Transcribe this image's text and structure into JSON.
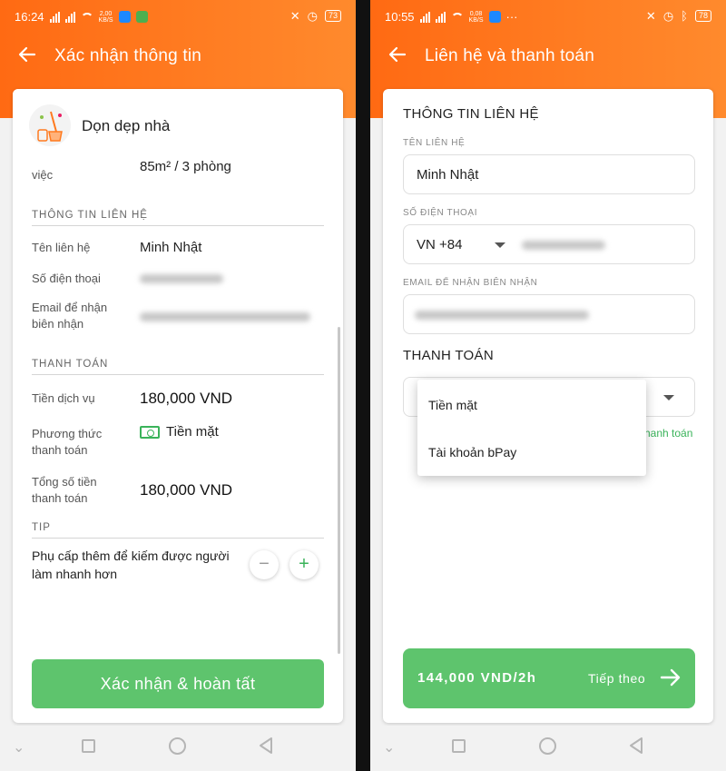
{
  "left": {
    "status": {
      "time": "16:24",
      "data_rate": "2,00\nKB/S",
      "battery": "73"
    },
    "appbar": {
      "title": "Xác nhận thông tin"
    },
    "service": {
      "name": "Dọn dẹp nhà"
    },
    "workload": {
      "label_partial": "việc",
      "value": "85m² / 3 phòng"
    },
    "contact": {
      "section": "THÔNG TIN LIÊN HỆ",
      "name_label": "Tên liên hệ",
      "name_value": "Minh Nhật",
      "phone_label": "Số điện thoại",
      "email_label_1": "Email để nhận",
      "email_label_2": "biên nhận"
    },
    "payment": {
      "section": "THANH TOÁN",
      "service_fee_label": "Tiền dịch vụ",
      "service_fee_value": "180,000 VND",
      "method_label_1": "Phương thức",
      "method_label_2": "thanh toán",
      "method_value": "Tiền mặt",
      "total_label_1": "Tổng số tiền",
      "total_label_2": "thanh toán",
      "total_value": "180,000 VND"
    },
    "tip": {
      "section": "TIP",
      "text": "Phụ cấp thêm để kiếm được người làm nhanh hơn",
      "minus": "−",
      "plus": "+"
    },
    "cta": "Xác nhận & hoàn tất"
  },
  "right": {
    "status": {
      "time": "10:55",
      "data_rate": "0,08\nKB/S",
      "battery": "78"
    },
    "appbar": {
      "title": "Liên hệ và thanh toán"
    },
    "contact_heading": "THÔNG TIN LIÊN HỆ",
    "name_label": "TÊN LIÊN HỆ",
    "name_value": "Minh Nhật",
    "phone_label": "SỐ ĐIỆN THOẠI",
    "country_code": "VN +84",
    "email_label": "EMAIL ĐỂ NHẬN BIÊN NHẬN",
    "payment_heading": "THANH TOÁN",
    "payment_hint_partial": "hanh toán",
    "dropdown": [
      "Tiền mặt",
      "Tài khoản bPay"
    ],
    "cta_price": "144,000 VND/2h",
    "cta_next": "Tiếp theo"
  },
  "colors": {
    "accent_orange": "#ff7a1f",
    "accent_green": "#5ec46d"
  }
}
